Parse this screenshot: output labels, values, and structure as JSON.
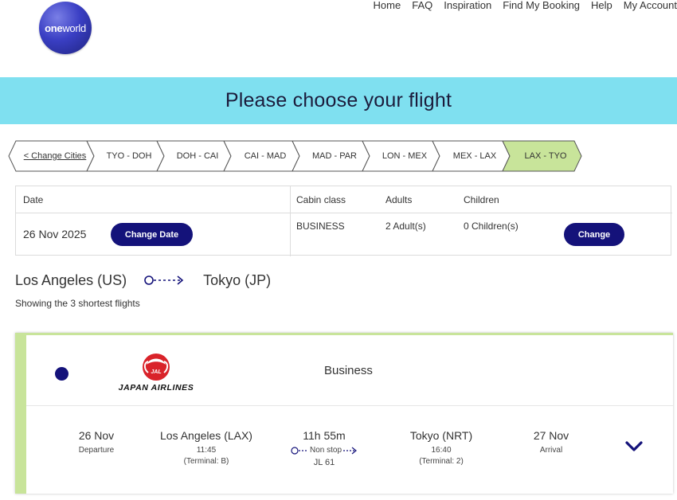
{
  "logo": {
    "text_bold": "one",
    "text_rest": "world"
  },
  "nav": [
    "Home",
    "FAQ",
    "Inspiration",
    "Find My Booking",
    "Help",
    "My Account"
  ],
  "banner": {
    "title": "Please choose your flight"
  },
  "steps": [
    {
      "label": "< Change Cities",
      "active": false,
      "link": true
    },
    {
      "label": "TYO - DOH",
      "active": false,
      "link": false
    },
    {
      "label": "DOH - CAI",
      "active": false,
      "link": false
    },
    {
      "label": "CAI - MAD",
      "active": false,
      "link": false
    },
    {
      "label": "MAD - PAR",
      "active": false,
      "link": false
    },
    {
      "label": "LON - MEX",
      "active": false,
      "link": false
    },
    {
      "label": "MEX - LAX",
      "active": false,
      "link": false
    },
    {
      "label": "LAX - TYO",
      "active": true,
      "link": false
    }
  ],
  "summary": {
    "date_label": "Date",
    "date_value": "26 Nov 2025",
    "change_date_label": "Change Date",
    "cabin_label": "Cabin class",
    "cabin_value": "BUSINESS",
    "adults_label": "Adults",
    "adults_value": "2 Adult(s)",
    "children_label": "Children",
    "children_value": "0 Children(s)",
    "change_label": "Change"
  },
  "route": {
    "from": "Los Angeles (US)",
    "to": "Tokyo (JP)"
  },
  "showing": "Showing the 3 shortest flights",
  "flight": {
    "airline_name": "JAPAN AIRLINES",
    "airline_mark": "JAL",
    "cabin": "Business",
    "dep_date": "26 Nov",
    "dep_label": "Departure",
    "origin": "Los Angeles (LAX)",
    "dep_time": "11:45",
    "dep_terminal": "(Terminal: B)",
    "duration": "11h 55m",
    "stops": "Non stop",
    "flight_no": "JL 61",
    "destination": "Tokyo (NRT)",
    "arr_time": "16:40",
    "arr_terminal": "(Terminal: 2)",
    "arr_date": "27 Nov",
    "arr_label": "Arrival"
  },
  "colors": {
    "banner": "#7fe0f0",
    "primary_button": "#14127a",
    "active_step": "#c8e49a",
    "card_accent": "#c8e49a",
    "jal_red": "#d9232a"
  },
  "icons": [
    "oneworld-logo",
    "jal-crane-logo",
    "radio-selected-icon",
    "route-arrow-icon",
    "chevron-down-icon"
  ]
}
